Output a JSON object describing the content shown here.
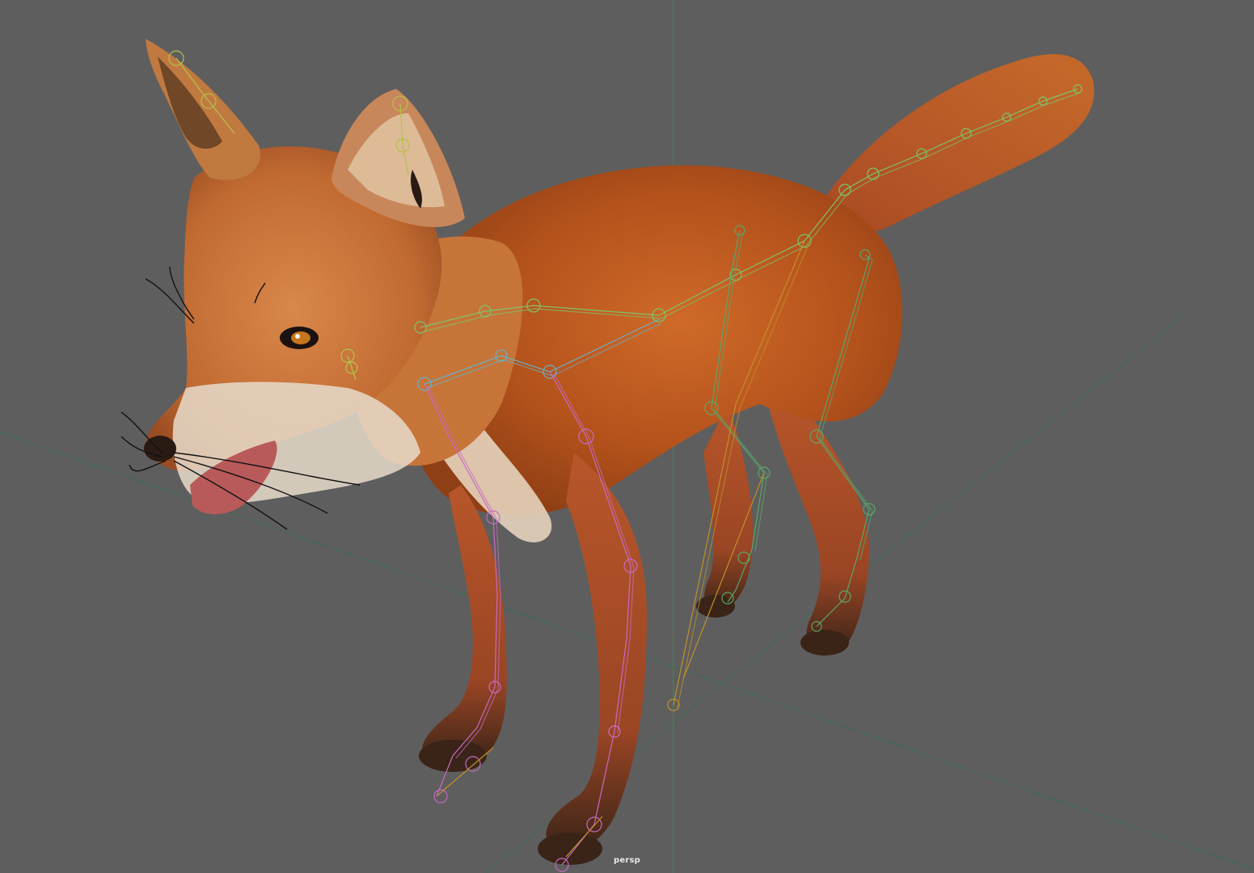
{
  "viewport": {
    "camera_name": "persp",
    "background_color": "#5e5e5e",
    "grid_color": "#3d6b52",
    "origin_axis_color": "#3e8a5a"
  },
  "model": {
    "subject": "fox-rig",
    "fur_color": "#b8561f",
    "fur_light_color": "#e2c8a6",
    "paw_color": "#3a2418"
  },
  "rig": {
    "spine_color": "#7ec46a",
    "front_leg_color": "#c86ac2",
    "rear_leg_color": "#5aa66a",
    "neck_color": "#6ab0c4",
    "ik_color": "#c0902a",
    "head_color": "#b4c24a"
  }
}
